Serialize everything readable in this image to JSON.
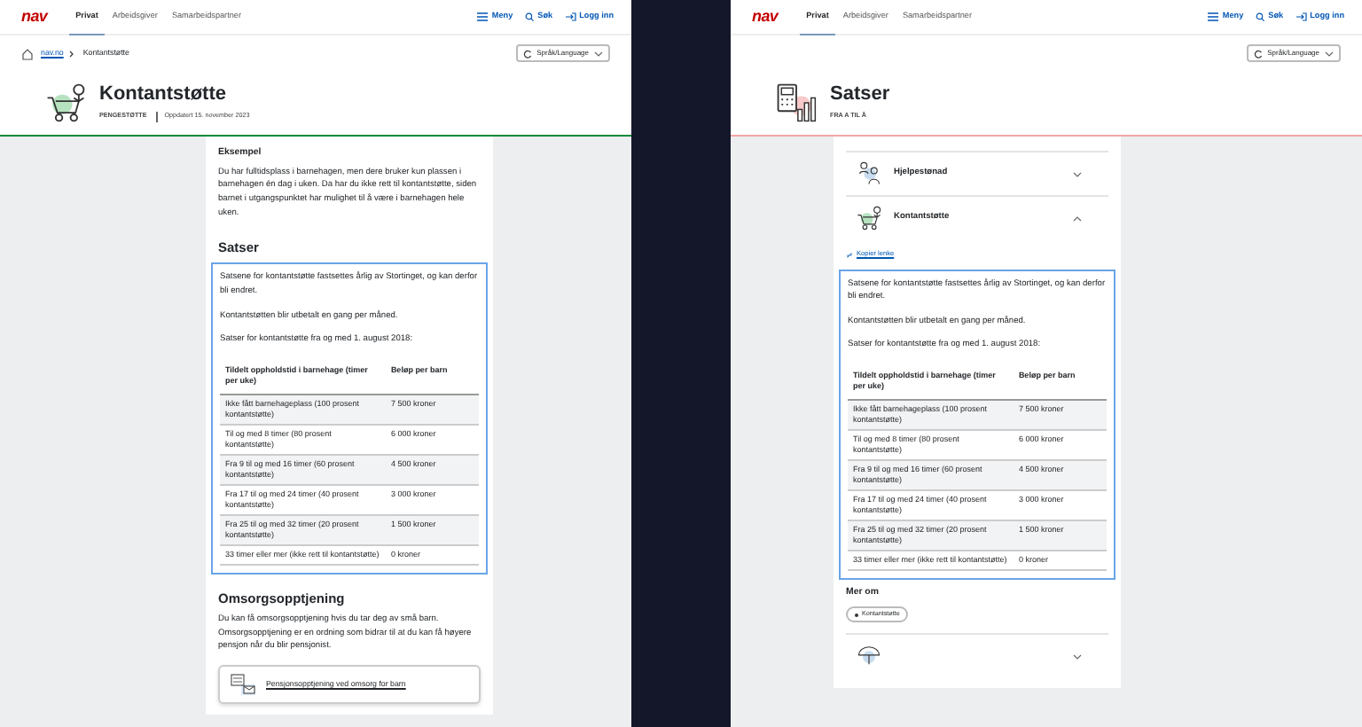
{
  "pages": [
    {
      "nav": {
        "logo": "nav",
        "tabs": [
          {
            "label": "Privat",
            "selected": true
          },
          {
            "label": "Arbeidsgiver",
            "selected": false
          },
          {
            "label": "Samarbeidspartner",
            "selected": false
          }
        ],
        "actions": [
          "Meny",
          "Søk",
          "Logg inn"
        ]
      },
      "breadcrumb": [
        "nav.no",
        "Kontantstøtte"
      ],
      "language": "Språk/Language",
      "hero": {
        "title": "Kontantstøtte",
        "tag": "PENGESTØTTE",
        "updated": "Oppdatert 15. november 2023",
        "color": "#06893a"
      },
      "blocks": [
        {
          "kind": "subheading",
          "text": "Eksempel"
        },
        {
          "kind": "paragraph",
          "text": "Du har fulltidsplass i barnehagen, men dere bruker kun plassen i barnehagen én dag i uken. Da har du ikke rett til kontantstøtte, siden barnet i utgangspunktet har mulighet til å være i barnehagen hele uken."
        },
        {
          "kind": "heading",
          "text": "Satser"
        },
        {
          "kind": "highlight",
          "blocks": [
            {
              "kind": "paragraph",
              "text": "Satsene for kontantstøtte fastsettes årlig av Stortinget, og kan derfor bli endret."
            },
            {
              "kind": "paragraph",
              "text": "Kontantstøtten blir utbetalt en gang per måned."
            },
            {
              "kind": "paragraph",
              "text": "Satser for kontantstøtte fra og med 1. august 2018:"
            },
            {
              "kind": "table",
              "columns": [
                "Tildelt oppholdstid i barnehage (timer per uke)",
                "Beløp per barn"
              ],
              "rows": [
                [
                  "Ikke fått barnehageplass (100 prosent kontantstøtte)",
                  "7 500 kroner"
                ],
                [
                  "Til og med 8 timer (80 prosent kontantstøtte)",
                  "6 000 kroner"
                ],
                [
                  "Fra 9 til og med 16 timer (60 prosent kontantstøtte)",
                  "4 500 kroner"
                ],
                [
                  "Fra 17 til og med 24 timer (40 prosent kontantstøtte)",
                  "3 000 kroner"
                ],
                [
                  "Fra 25 til og med 32 timer (20 prosent kontantstøtte)",
                  "1 500 kroner"
                ],
                [
                  "33 timer eller mer (ikke rett til kontantstøtte)",
                  "0 kroner"
                ]
              ]
            }
          ]
        },
        {
          "kind": "heading",
          "text": "Omsorgsopptjening"
        },
        {
          "kind": "paragraph",
          "text": "Du kan få omsorgsopptjening hvis du tar deg av små barn. Omsorgsopptjening er en ordning som bidrar til at du kan få høyere pensjon når du blir pensjonist."
        },
        {
          "kind": "link_card",
          "text": "Pensjonsopptjening ved omsorg for barn"
        }
      ]
    },
    {
      "nav": {
        "logo": "nav",
        "tabs": [
          {
            "label": "Privat",
            "selected": true
          },
          {
            "label": "Arbeidsgiver",
            "selected": false
          },
          {
            "label": "Samarbeidspartner",
            "selected": false
          }
        ],
        "actions": [
          "Meny",
          "Søk",
          "Logg inn"
        ]
      },
      "language": "Språk/Language",
      "hero": {
        "title": "Satser",
        "tag": "FRA A TIL Å",
        "color": "#f3a6a6"
      },
      "blocks": [
        {
          "kind": "accordion_item",
          "text": "Hjelpestønad",
          "expanded": false
        },
        {
          "kind": "accordion_item",
          "text": "Kontantstøtte",
          "expanded": true
        },
        {
          "kind": "copy_link",
          "text": "Kopier lenke"
        },
        {
          "kind": "highlight",
          "blocks": [
            {
              "kind": "paragraph",
              "text": "Satsene for kontantstøtte fastsettes årlig av Stortinget, og kan derfor bli endret."
            },
            {
              "kind": "paragraph",
              "text": "Kontantstøtten blir utbetalt en gang per måned."
            },
            {
              "kind": "paragraph",
              "text": "Satser for kontantstøtte fra og med 1. august 2018:"
            },
            {
              "kind": "table",
              "columns": [
                "Tildelt oppholdstid i barnehage (timer per uke)",
                "Beløp per barn"
              ],
              "rows": [
                [
                  "Ikke fått barnehageplass (100 prosent kontantstøtte)",
                  "7 500 kroner"
                ],
                [
                  "Til og med 8 timer (80 prosent kontantstøtte)",
                  "6 000 kroner"
                ],
                [
                  "Fra 9 til og med 16 timer (60 prosent kontantstøtte)",
                  "4 500 kroner"
                ],
                [
                  "Fra 17 til og med 24 timer (40 prosent kontantstøtte)",
                  "3 000 kroner"
                ],
                [
                  "Fra 25 til og med 32 timer (20 prosent kontantstøtte)",
                  "1 500 kroner"
                ],
                [
                  "33 timer eller mer (ikke rett til kontantstøtte)",
                  "0 kroner"
                ]
              ]
            }
          ]
        },
        {
          "kind": "subheading",
          "text": "Mer om"
        },
        {
          "kind": "chip",
          "text": "Kontantstøtte"
        },
        {
          "kind": "accordion_item",
          "expanded": false
        }
      ]
    }
  ]
}
